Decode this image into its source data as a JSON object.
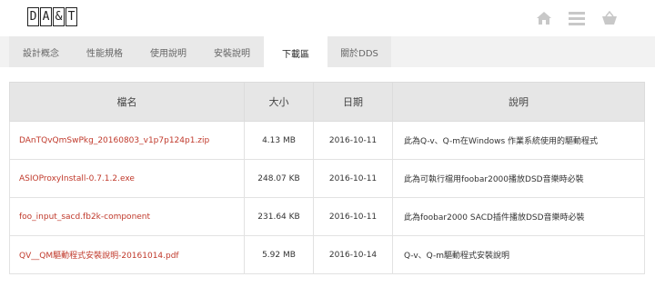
{
  "logo": {
    "letters": [
      "D",
      "A",
      "&",
      "T"
    ]
  },
  "header": {
    "icons": [
      "home-icon",
      "menu-icon",
      "cart-icon"
    ],
    "icon_color": "#c8c8c8"
  },
  "tabs": [
    {
      "label": "設計概念",
      "active": false
    },
    {
      "label": "性能規格",
      "active": false
    },
    {
      "label": "使用說明",
      "active": false
    },
    {
      "label": "安裝說明",
      "active": false
    },
    {
      "label": "下載區",
      "active": true
    },
    {
      "label": "關於DDS",
      "active": false
    }
  ],
  "table": {
    "headers": {
      "name": "檔名",
      "size": "大小",
      "date": "日期",
      "desc": "說明"
    },
    "rows": [
      {
        "name": "DAnTQvQmSwPkg_20160803_v1p7p124p1.zip",
        "size": "4.13 MB",
        "date": "2016-10-11",
        "desc": "此為Q-v、Q-m在Windows 作業系統使用的驅動程式"
      },
      {
        "name": "ASIOProxyInstall-0.7.1.2.exe",
        "size": "248.07 KB",
        "date": "2016-10-11",
        "desc": "此為可執行檔用foobar2000播放DSD音樂時必裝"
      },
      {
        "name": "foo_input_sacd.fb2k-component",
        "size": "231.64 KB",
        "date": "2016-10-11",
        "desc": "此為foobar2000 SACD插件播放DSD音樂時必裝"
      },
      {
        "name": "QV__QM驅動程式安裝說明-20161014.pdf",
        "size": "5.92 MB",
        "date": "2016-10-14",
        "desc": "Q-v、Q-m驅動程式安裝說明"
      }
    ]
  },
  "colors": {
    "link": "#c0392b",
    "header_bg": "#e6e6e6",
    "tab_bg": "#e9e9e9"
  }
}
